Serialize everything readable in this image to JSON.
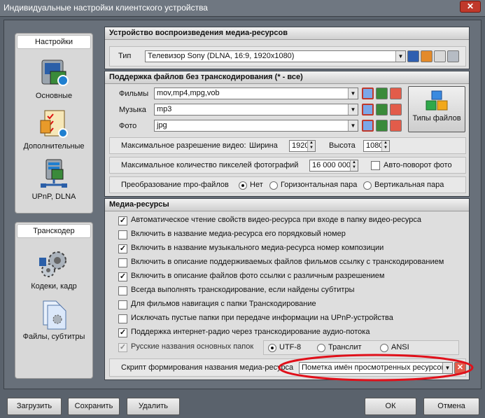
{
  "window": {
    "title": "Индивидуальные настройки клиентского устройства",
    "close": "✕"
  },
  "sidebar": {
    "settings_header": "Настройки",
    "settings_items": [
      {
        "label": "Основные",
        "icon": "device-icon"
      },
      {
        "label": "Дополнительные",
        "icon": "checklist-icon"
      },
      {
        "label": "UPnP, DLNA",
        "icon": "network-icon"
      }
    ],
    "transcoder_header": "Транскодер",
    "transcoder_items": [
      {
        "label": "Кодеки, кадр",
        "icon": "gears-icon"
      },
      {
        "label": "Файлы, субтитры",
        "icon": "files-icon"
      }
    ]
  },
  "device": {
    "header": "Устройство воспроизведения медиа-ресурсов",
    "type_label": "Тип",
    "type_value": "Телевизор Sony (DLNA, 16:9, 1920x1080)"
  },
  "formats": {
    "header": "Поддержка файлов без транскодирования (* - все)",
    "movies_label": "Фильмы",
    "movies_value": "mov,mp4,mpg,vob",
    "music_label": "Музыка",
    "music_value": "mp3",
    "photo_label": "Фото",
    "photo_value": "jpg",
    "file_types_button": "Типы файлов",
    "max_res_label": "Максимальное разрешение видео:",
    "width_label": "Ширина",
    "width_value": "1920",
    "height_label": "Высота",
    "height_value": "1080",
    "max_pixels_label": "Максимальное количество пикселей фотографий",
    "max_pixels_value": "16 000 000",
    "autorotate_label": "Авто-поворот фото",
    "autorotate_checked": false,
    "mpo_label": "Преобразование mpo-файлов",
    "mpo_options": [
      "Нет",
      "Горизонтальная пара",
      "Вертикальная пара"
    ],
    "mpo_selected": 0
  },
  "media": {
    "header": "Медиа-ресурсы",
    "options": [
      {
        "label": "Автоматическое чтение свойств видео-ресурса при входе в папку видео-ресурса",
        "checked": true
      },
      {
        "label": "Включить в название медиа-ресурса его порядковый номер",
        "checked": false
      },
      {
        "label": "Включить в название музыкального медиа-ресурса номер композиции",
        "checked": true
      },
      {
        "label": "Включить в описание поддерживаемых файлов фильмов ссылку с транскодированием",
        "checked": false
      },
      {
        "label": "Включить в описание файлов фото ссылки с различным разрешением",
        "checked": true
      },
      {
        "label": "Всегда выполнять транскодирование, если найдены субтитры",
        "checked": false
      },
      {
        "label": "Для фильмов навигация с папки Транскодирование",
        "checked": false
      },
      {
        "label": "Исключать пустые папки при передаче информации на  UPnP-устройства",
        "checked": false
      },
      {
        "label": "Поддержка интернет-радио через транскодирование аудио-потока",
        "checked": true
      }
    ],
    "russian_names_label": "Русские названия основных папок",
    "russian_names_checked": true,
    "encoding_options": [
      "UTF-8",
      "Транслит",
      "ANSI"
    ],
    "encoding_selected": 0,
    "script_label": "Скрипт формирования названия медиа-ресурса",
    "script_value": "Пометка имён просмотренных ресурсов"
  },
  "footer": {
    "load": "Загрузить",
    "save": "Сохранить",
    "delete": "Удалить",
    "ok": "ОК",
    "cancel": "Отмена"
  },
  "colors": {
    "highlight_ring": "#e0101a",
    "accent_blue": "#2a6fd6"
  }
}
